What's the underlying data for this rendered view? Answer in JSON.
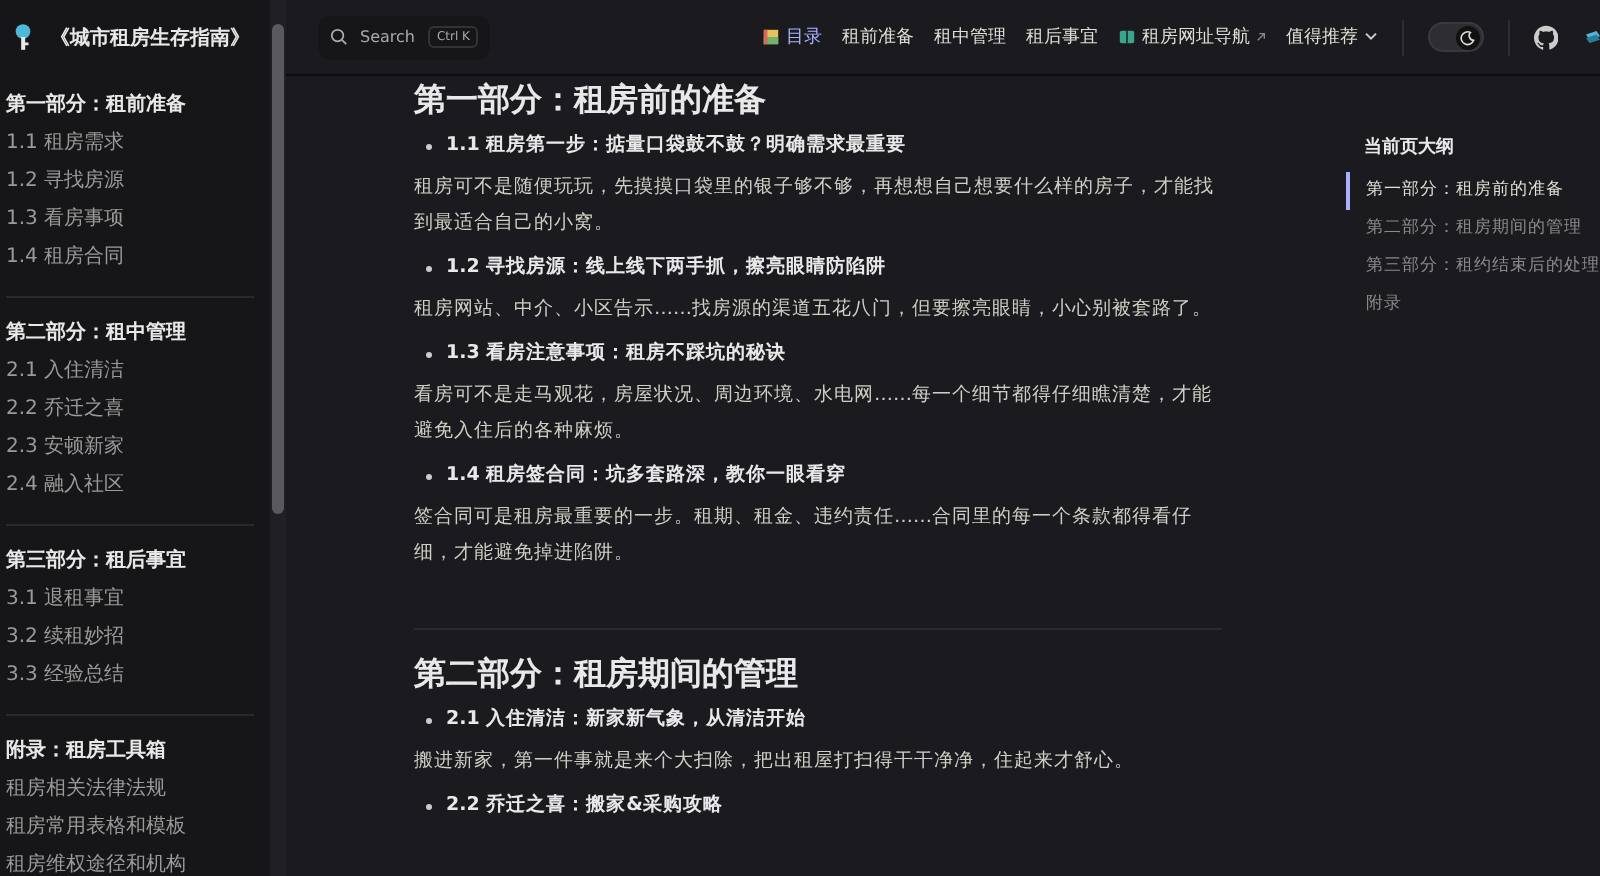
{
  "site_title": "《城市租房生存指南》",
  "sidebar": {
    "sections": [
      {
        "title": "第一部分：租前准备",
        "items": [
          "1.1 租房需求",
          "1.2 寻找房源",
          "1.3 看房事项",
          "1.4 租房合同"
        ]
      },
      {
        "title": "第二部分：租中管理",
        "items": [
          "2.1 入住清洁",
          "2.2 乔迁之喜",
          "2.3 安顿新家",
          "2.4 融入社区"
        ]
      },
      {
        "title": "第三部分：租后事宜",
        "items": [
          "3.1 退租事宜",
          "3.2 续租妙招",
          "3.3 经验总结"
        ]
      },
      {
        "title": "附录：租房工具箱",
        "items": [
          "租房相关法律法规",
          "租房常用表格和模板",
          "租房维权途径和机构"
        ]
      }
    ]
  },
  "search": {
    "placeholder": "Search",
    "shortcut": "Ctrl K"
  },
  "nav": [
    {
      "label": "目录",
      "kind": "toc",
      "selected": true
    },
    {
      "label": "租前准备",
      "kind": "link",
      "selected": false
    },
    {
      "label": "租中管理",
      "kind": "link",
      "selected": false
    },
    {
      "label": "租后事宜",
      "kind": "link",
      "selected": false
    },
    {
      "label": "租房网址导航",
      "kind": "external",
      "selected": false
    },
    {
      "label": "值得推荐",
      "kind": "dropdown",
      "selected": false
    }
  ],
  "theme_dark": true,
  "content": [
    {
      "title": "第一部分：租房前的准备",
      "items": [
        {
          "kind": "subheading",
          "text": "1.1 租房第一步：掂量口袋鼓不鼓？明确需求最重要"
        },
        {
          "kind": "paragraph",
          "text": "租房可不是随便玩玩，先摸摸口袋里的银子够不够，再想想自己想要什么样的房子，才能找到最适合自己的小窝。"
        },
        {
          "kind": "subheading",
          "text": "1.2 寻找房源：线上线下两手抓，擦亮眼睛防陷阱"
        },
        {
          "kind": "paragraph",
          "text": "租房网站、中介、小区告示……找房源的渠道五花八门，但要擦亮眼睛，小心别被套路了。"
        },
        {
          "kind": "subheading",
          "text": "1.3 看房注意事项：租房不踩坑的秘诀"
        },
        {
          "kind": "paragraph",
          "text": "看房可不是走马观花，房屋状况、周边环境、水电网……每一个细节都得仔细瞧清楚，才能避免入住后的各种麻烦。"
        },
        {
          "kind": "subheading",
          "text": "1.4 租房签合同：坑多套路深，教你一眼看穿"
        },
        {
          "kind": "paragraph",
          "text": "签合同可是租房最重要的一步。租期、租金、违约责任……合同里的每一个条款都得看仔细，才能避免掉进陷阱。"
        }
      ]
    },
    {
      "title": "第二部分：租房期间的管理",
      "items": [
        {
          "kind": "subheading",
          "text": "2.1 入住清洁：新家新气象，从清洁开始"
        },
        {
          "kind": "paragraph",
          "text": "搬进新家，第一件事就是来个大扫除，把出租屋打扫得干干净净，住起来才舒心。"
        },
        {
          "kind": "subheading",
          "text": "2.2 乔迁之喜：搬家&采购攻略"
        }
      ]
    }
  ],
  "outline": {
    "title": "当前页大纲",
    "items": [
      {
        "label": "第一部分：租房前的准备",
        "selected": true
      },
      {
        "label": "第二部分：租房期间的管理",
        "selected": false
      },
      {
        "label": "第三部分：租约结束后的处理",
        "selected": false
      },
      {
        "label": "附录",
        "selected": false
      }
    ]
  }
}
